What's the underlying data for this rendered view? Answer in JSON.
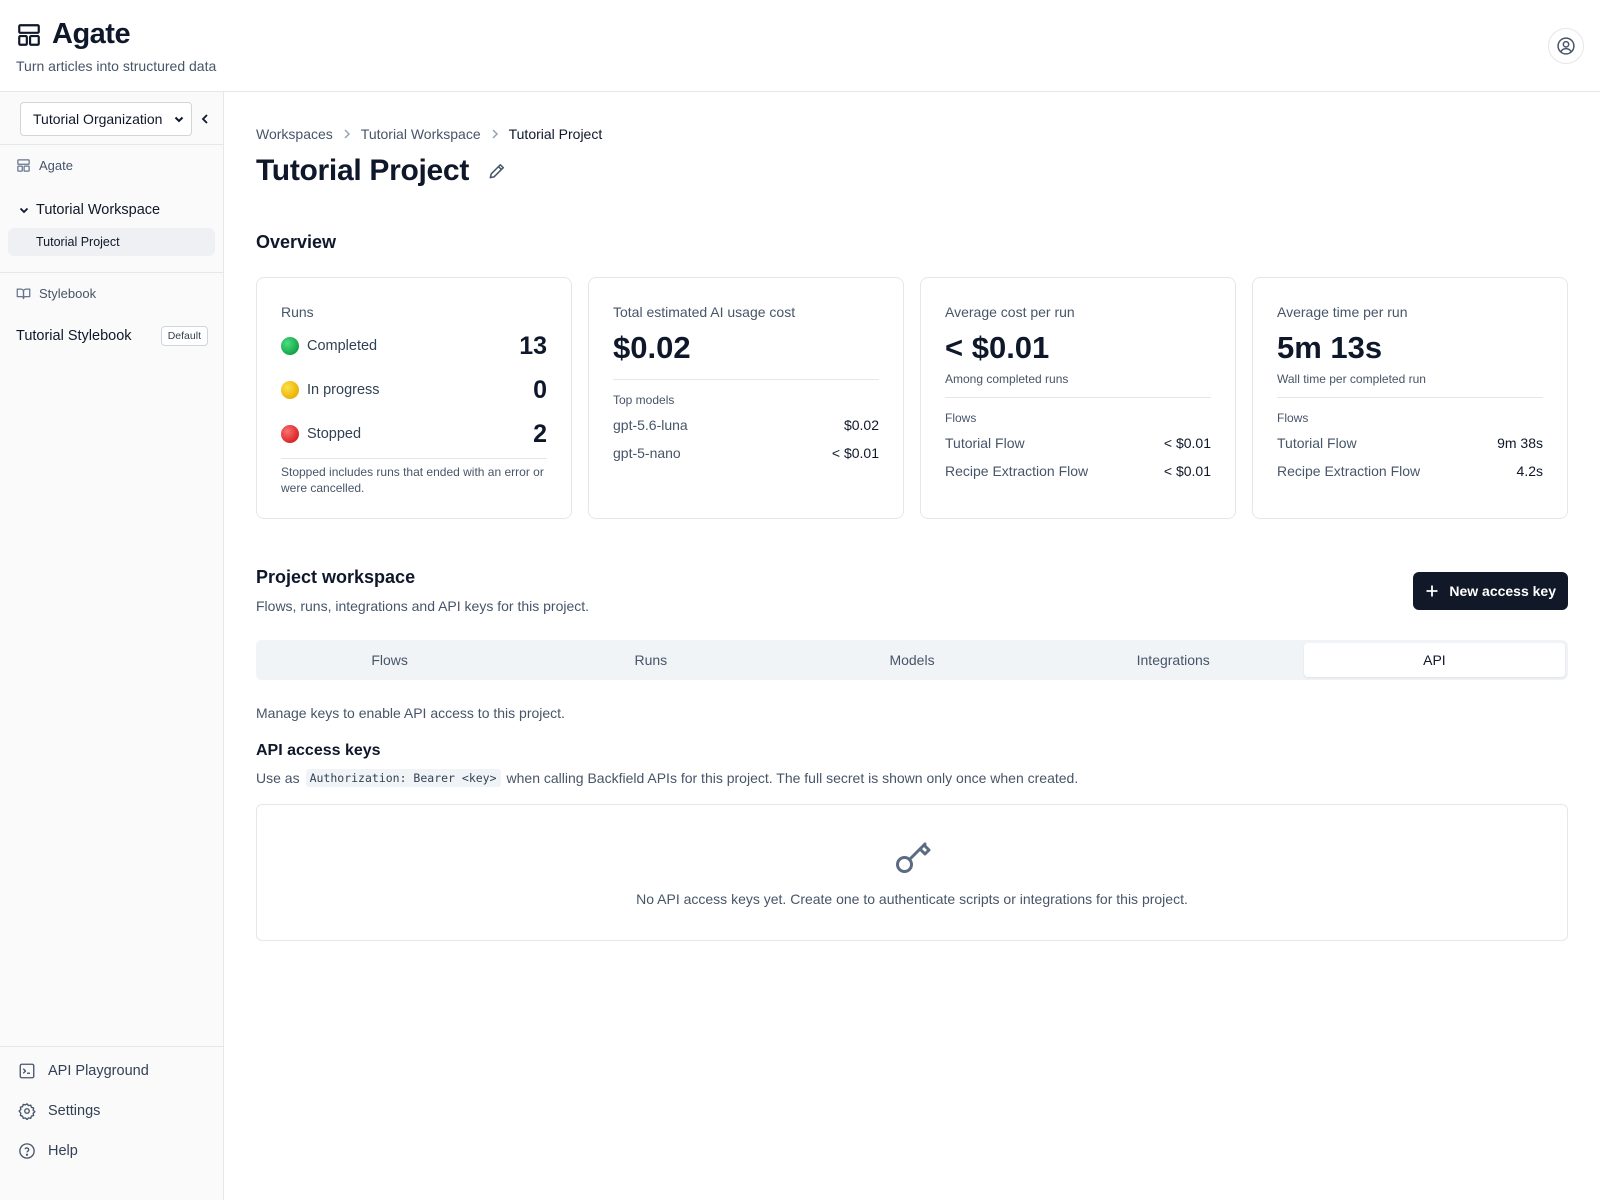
{
  "app": {
    "name": "Agate",
    "tagline": "Turn articles into structured data"
  },
  "sidebar": {
    "org_select": "Tutorial Organization",
    "app_section": "Agate",
    "workspace": "Tutorial Workspace",
    "project": "Tutorial Project",
    "stylebook_section": "Stylebook",
    "stylebook_item": "Tutorial Stylebook",
    "stylebook_badge": "Default",
    "bottom": {
      "api_playground": "API Playground",
      "settings": "Settings",
      "help": "Help"
    }
  },
  "breadcrumb": [
    "Workspaces",
    "Tutorial Workspace",
    "Tutorial Project"
  ],
  "page": {
    "title": "Tutorial Project"
  },
  "overview": {
    "title": "Overview",
    "runs": {
      "label": "Runs",
      "items": [
        {
          "label": "Completed",
          "count": "13",
          "color": "#16a34a"
        },
        {
          "label": "In progress",
          "count": "0",
          "color": "#eab308"
        },
        {
          "label": "Stopped",
          "count": "2",
          "color": "#dc2626"
        }
      ],
      "footnote": "Stopped includes runs that ended with an error or were cancelled."
    },
    "cost": {
      "label": "Total estimated AI usage cost",
      "value": "$0.02",
      "models_label": "Top models",
      "models": [
        {
          "name": "gpt-5.6-luna",
          "value": "$0.02"
        },
        {
          "name": "gpt-5-nano",
          "value": "< $0.01"
        }
      ]
    },
    "avg_cost": {
      "label": "Average cost per run",
      "value": "< $0.01",
      "sub": "Among completed runs",
      "flows_label": "Flows",
      "flows": [
        {
          "name": "Tutorial Flow",
          "value": "< $0.01"
        },
        {
          "name": "Recipe Extraction Flow",
          "value": "< $0.01"
        }
      ]
    },
    "avg_time": {
      "label": "Average time per run",
      "value": "5m 13s",
      "sub": "Wall time per completed run",
      "flows_label": "Flows",
      "flows": [
        {
          "name": "Tutorial Flow",
          "value": "9m 38s"
        },
        {
          "name": "Recipe Extraction Flow",
          "value": "4.2s"
        }
      ]
    }
  },
  "workspace": {
    "title": "Project workspace",
    "subtitle": "Flows, runs, integrations and API keys for this project.",
    "new_key_button": "New access key",
    "tabs": [
      "Flows",
      "Runs",
      "Models",
      "Integrations",
      "API"
    ],
    "active_tab": "API"
  },
  "api": {
    "description": "Manage keys to enable API access to this project.",
    "title": "API access keys",
    "usage_prefix": "Use as",
    "usage_code": "Authorization: Bearer <key>",
    "usage_suffix": "when calling Backfield APIs for this project. The full secret is shown only once when created.",
    "empty_text": "No API access keys yet. Create one to authenticate scripts or integrations for this project."
  },
  "icons": {
    "brand": "layout-dashboard-icon",
    "user": "user-circle-icon",
    "key": "key-icon",
    "edit": "pencil-icon"
  }
}
